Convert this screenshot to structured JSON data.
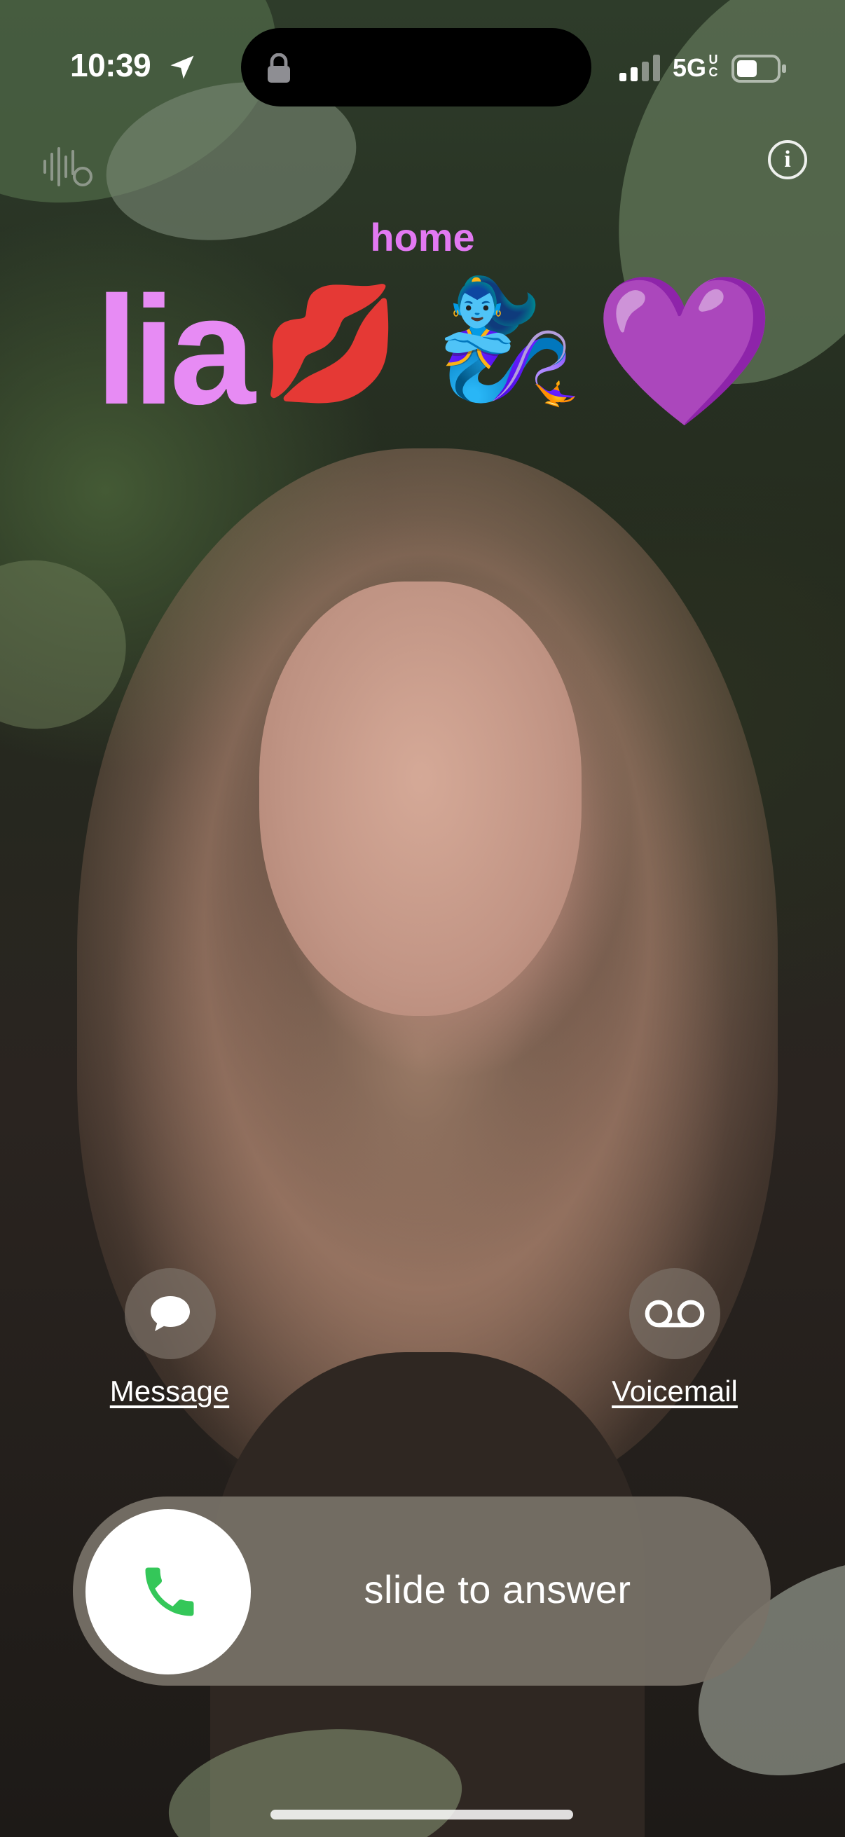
{
  "status_bar": {
    "time": "10:39",
    "network": "5G",
    "network_badge": "UC"
  },
  "caller": {
    "label": "home",
    "name": "lia",
    "emojis": [
      "💋",
      "🧞‍♀️",
      "💜"
    ]
  },
  "actions": {
    "message_label": "Message",
    "voicemail_label": "Voicemail"
  },
  "slider": {
    "text": "slide to answer"
  },
  "colors": {
    "caller_accent": "#e78bf4",
    "answer_green": "#34c759"
  }
}
